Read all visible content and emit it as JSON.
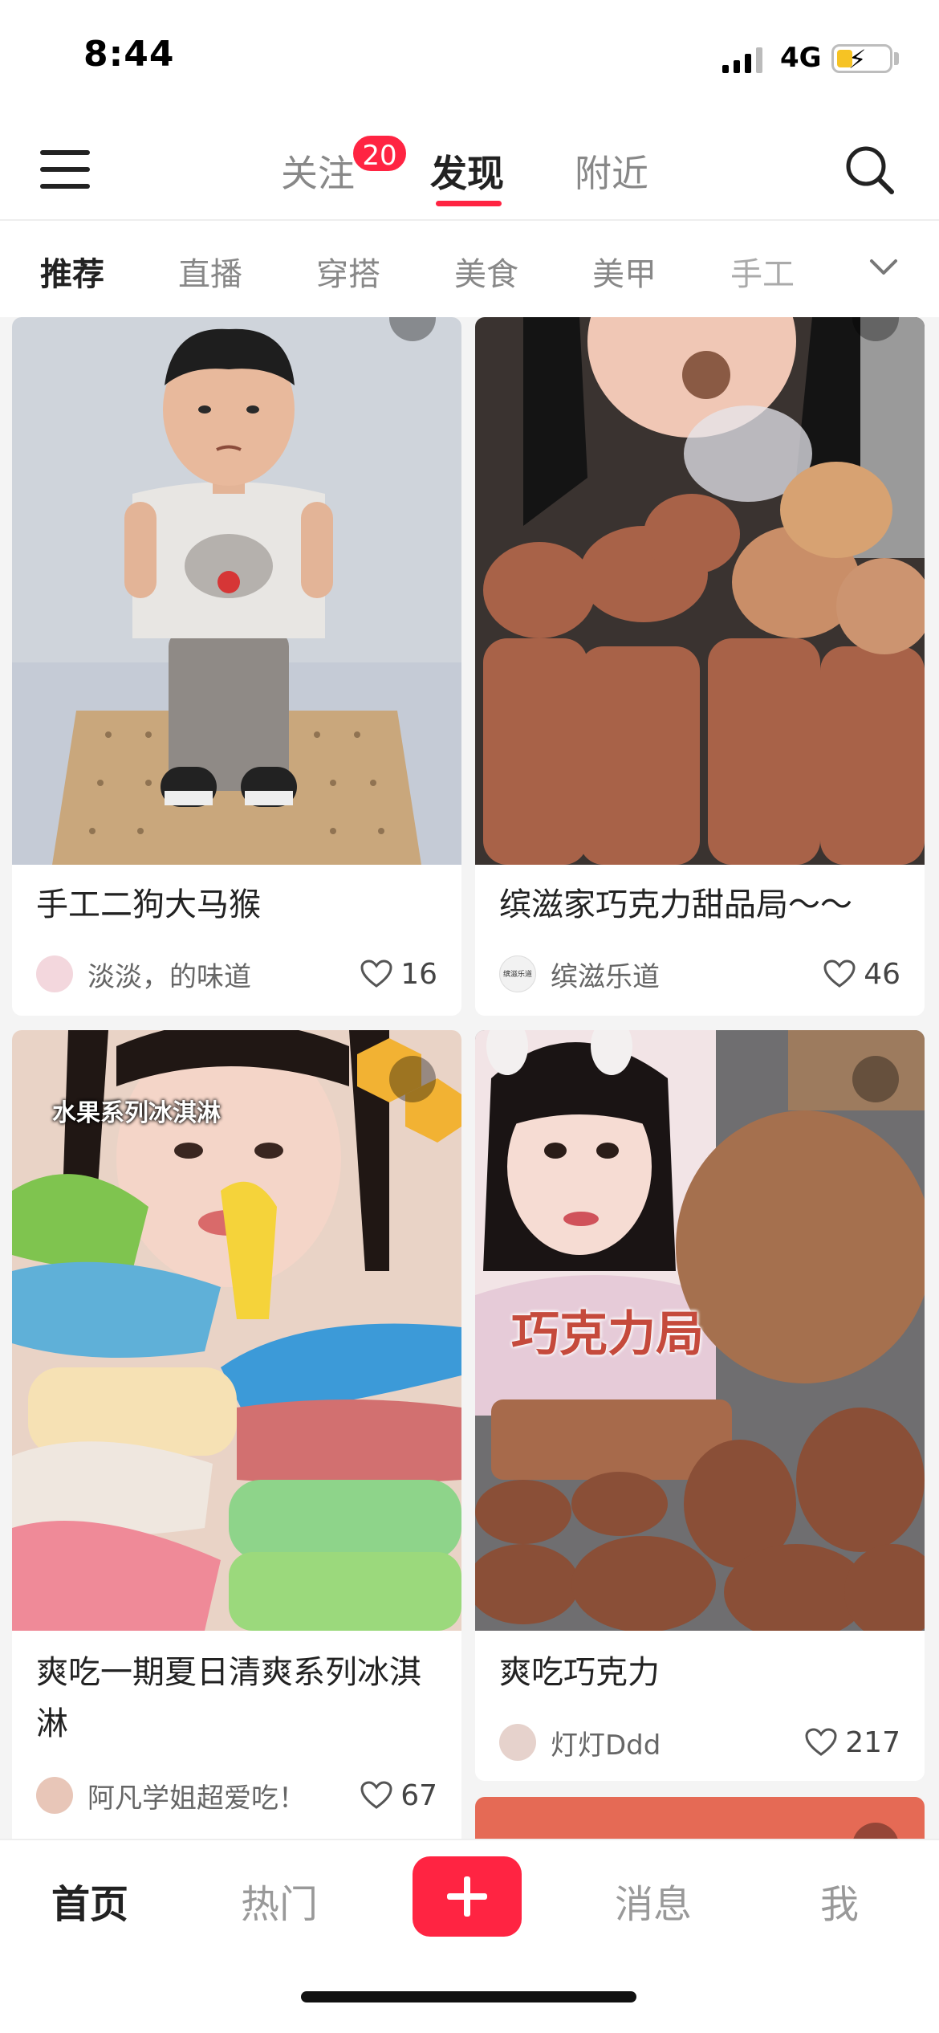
{
  "status_bar": {
    "time": "8:44",
    "network": "4G",
    "battery_level": 0.3
  },
  "nav": {
    "tabs": [
      {
        "label": "关注",
        "active": false
      },
      {
        "label": "发现",
        "active": true
      },
      {
        "label": "附近",
        "active": false
      }
    ],
    "follow_badge": "20",
    "accent_color": "#ff2442"
  },
  "categories": [
    "推荐",
    "直播",
    "穿搭",
    "美食",
    "美甲",
    "手工"
  ],
  "active_category": "推荐",
  "feed": [
    {
      "title": "手工二狗大马猴",
      "author": "淡淡，的味道",
      "likes": "16",
      "video": true
    },
    {
      "title": "缤滋家巧克力甜品局～～",
      "author": "缤滋乐道",
      "likes": "46",
      "video": true
    },
    {
      "title": "爽吃一期夏日清爽系列冰淇淋",
      "author": "阿凡学姐超爱吃！",
      "likes": "67",
      "video": true,
      "overlay_text": "水果系列冰淇淋"
    },
    {
      "title": "爽吃巧克力",
      "author": "灯灯Ddd",
      "likes": "217",
      "video": true,
      "overlay_text": "巧克力局"
    }
  ],
  "avatar_text": {
    "card2": "缤滋乐道"
  },
  "tab_bar": {
    "items": [
      {
        "label": "首页",
        "active": true
      },
      {
        "label": "热门",
        "active": false
      },
      {
        "label": "消息",
        "active": false
      },
      {
        "label": "我",
        "active": false
      }
    ]
  }
}
